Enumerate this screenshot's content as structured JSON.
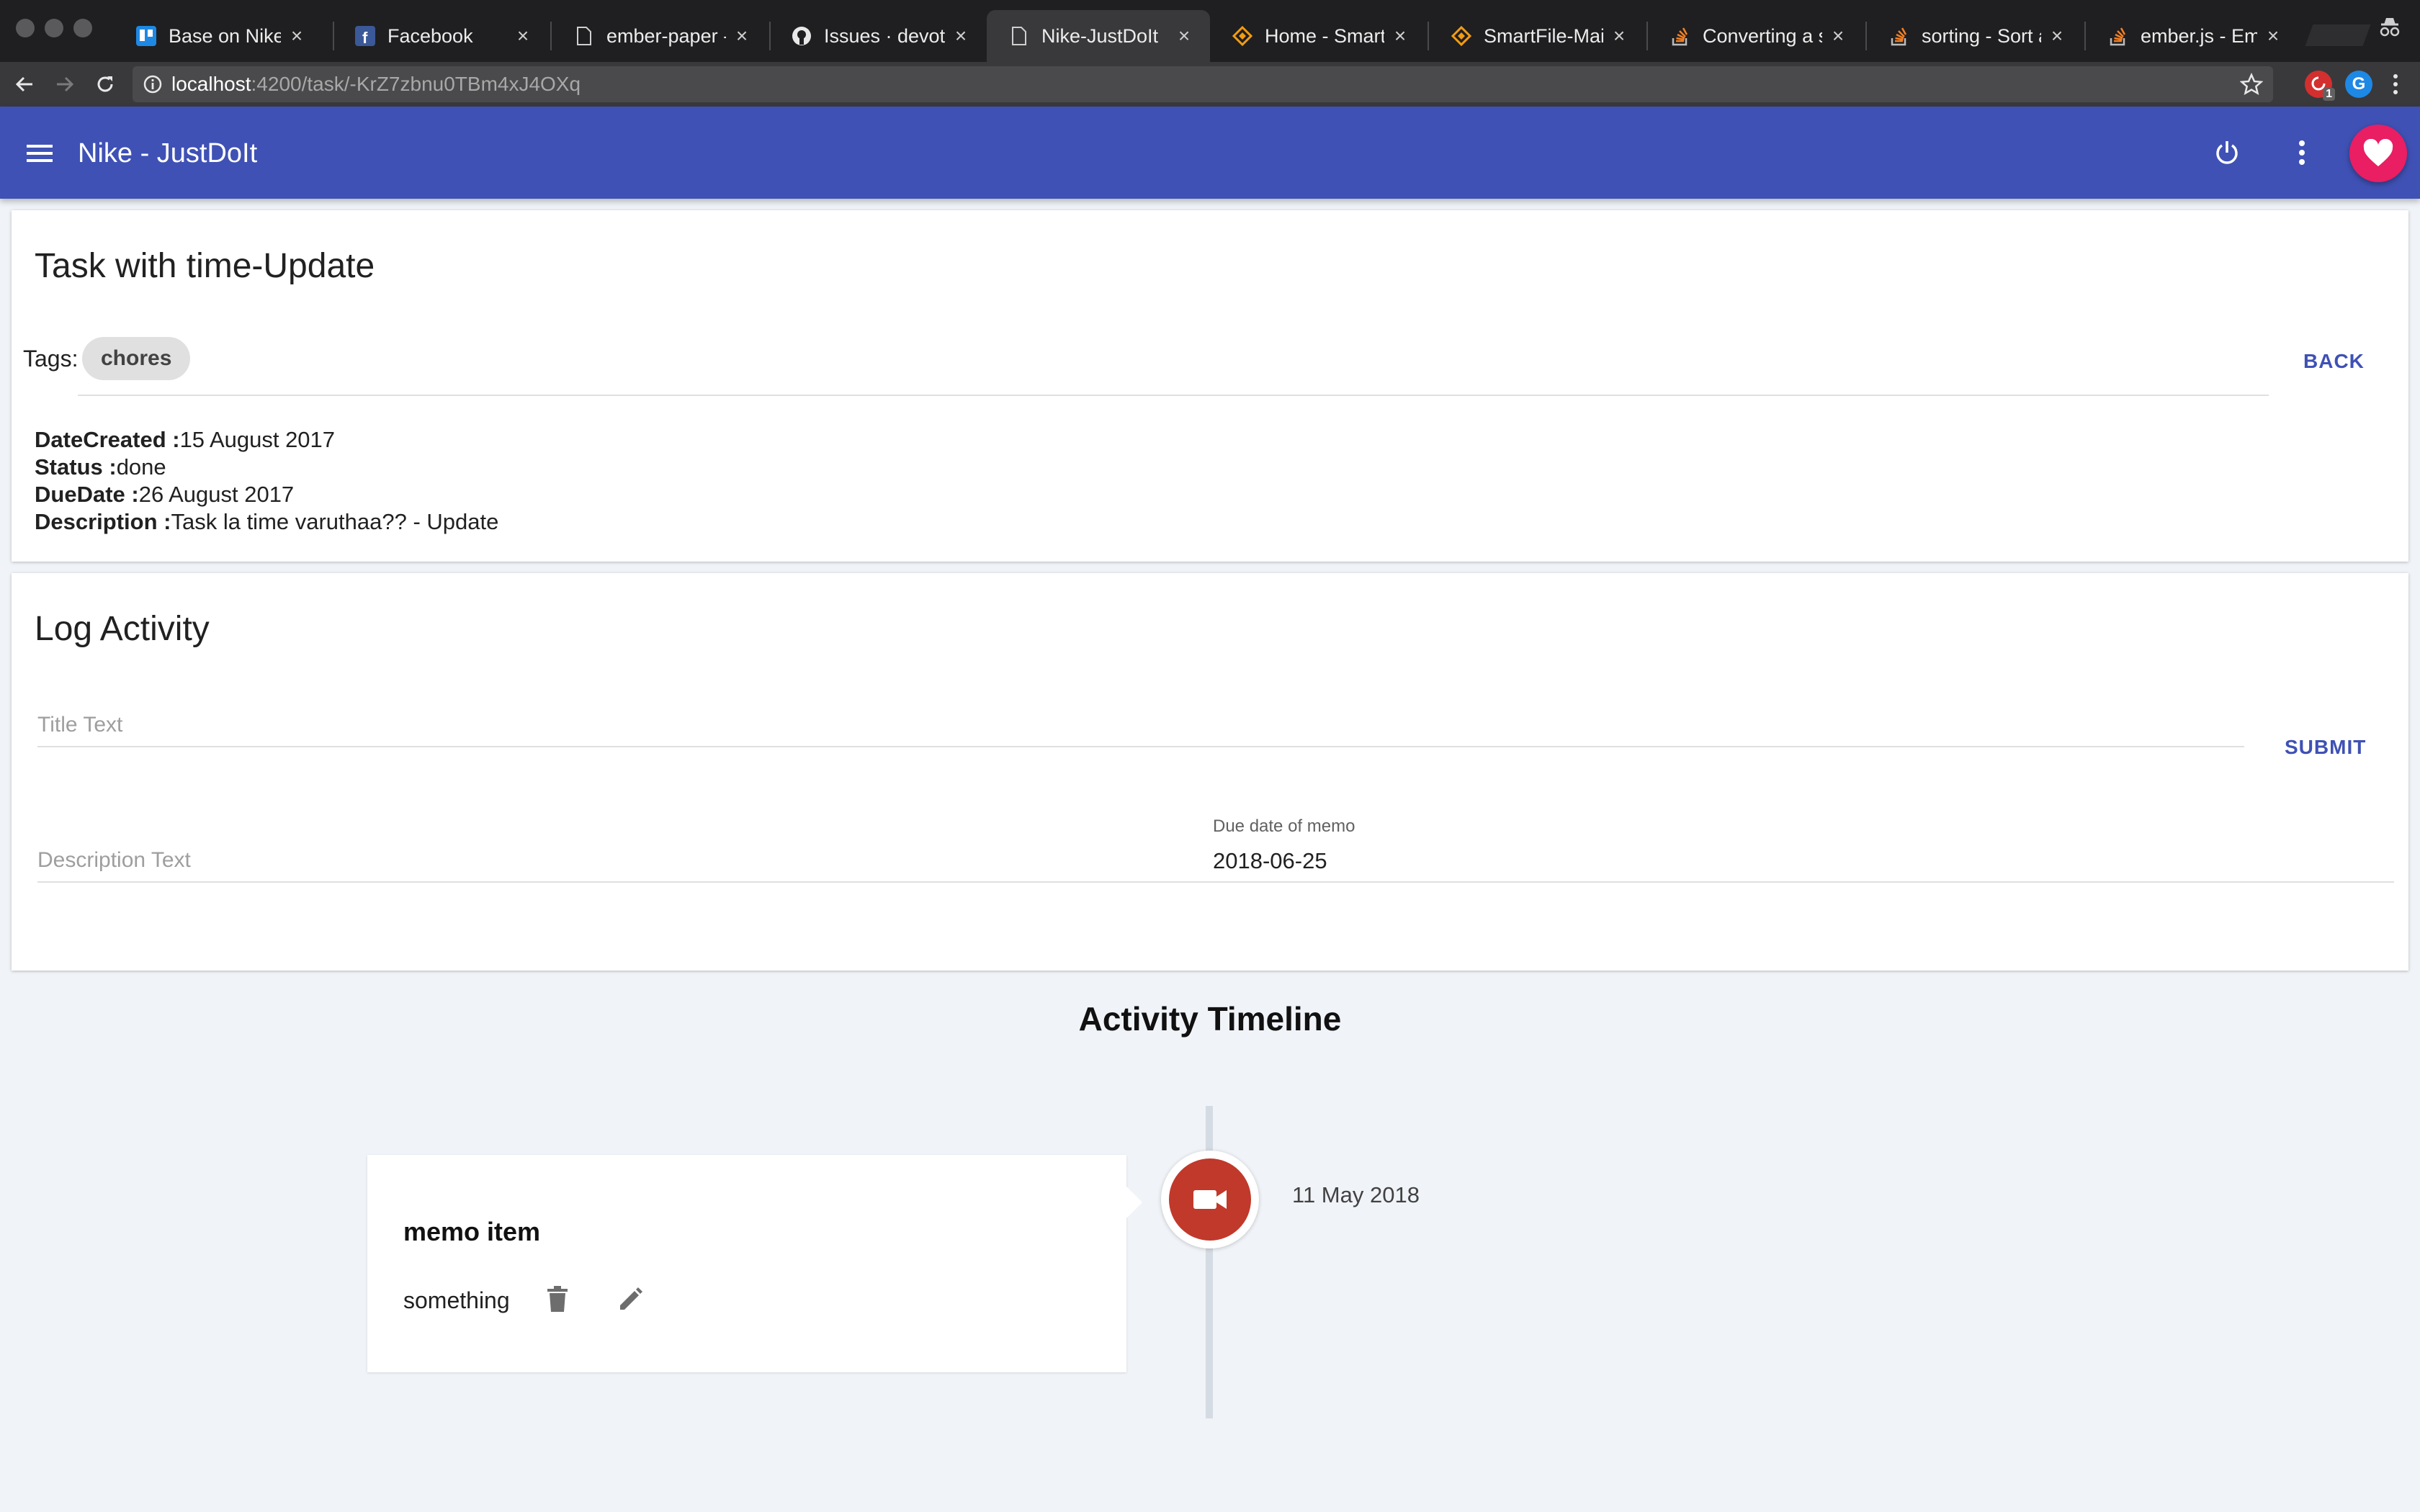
{
  "browser": {
    "tabs": [
      {
        "title": "Base on Nike-JustDoIt",
        "icon": "trello-icon",
        "active": false
      },
      {
        "title": "Facebook",
        "icon": "facebook-icon",
        "active": false
      },
      {
        "title": "ember-paper - The Ember approach to Material Design",
        "icon": "page-icon",
        "active": false
      },
      {
        "title": "Issues · devotox/ember-paper",
        "icon": "github-icon",
        "active": false
      },
      {
        "title": "Nike-JustDoIt",
        "icon": "page-icon",
        "active": true
      },
      {
        "title": "Home - SmartFile",
        "icon": "smartfile-icon",
        "active": false
      },
      {
        "title": "SmartFile-Main Web",
        "icon": "smartfile-icon",
        "active": false
      },
      {
        "title": "Converting a string",
        "icon": "stackoverflow-icon",
        "active": false
      },
      {
        "title": "sorting - Sort array",
        "icon": "stackoverflow-icon",
        "active": false
      },
      {
        "title": "ember.js - Ember",
        "icon": "stackoverflow-icon",
        "active": false
      }
    ],
    "url_host": "localhost",
    "url_rest": ":4200/task/-KrZ7zbnu0TBm4xJ4OXq",
    "extension_badge": "1"
  },
  "appbar": {
    "title": "Nike - JustDoIt",
    "color": "#3f51b5",
    "fab_color": "#e91e63"
  },
  "task": {
    "title": "Task with time-Update",
    "tags_label": "Tags:",
    "tags": [
      "chores"
    ],
    "back_label": "BACK",
    "details": [
      {
        "label": "DateCreated :",
        "value": "15 August 2017"
      },
      {
        "label": "Status :",
        "value": "done"
      },
      {
        "label": "DueDate :",
        "value": "26 August 2017"
      },
      {
        "label": "Description :",
        "value": "Task la time varuthaa?? - Update"
      }
    ]
  },
  "log": {
    "title": "Log Activity",
    "title_placeholder": "Title Text",
    "submit_label": "SUBMIT",
    "description_placeholder": "Description Text",
    "due_label": "Due date of memo",
    "due_value": "2018-06-25"
  },
  "timeline": {
    "heading": "Activity Timeline",
    "items": [
      {
        "title": "memo item",
        "body": "something",
        "date": "11 May 2018",
        "icon": "video-camera-icon",
        "dot_color": "#c0392b"
      }
    ]
  }
}
